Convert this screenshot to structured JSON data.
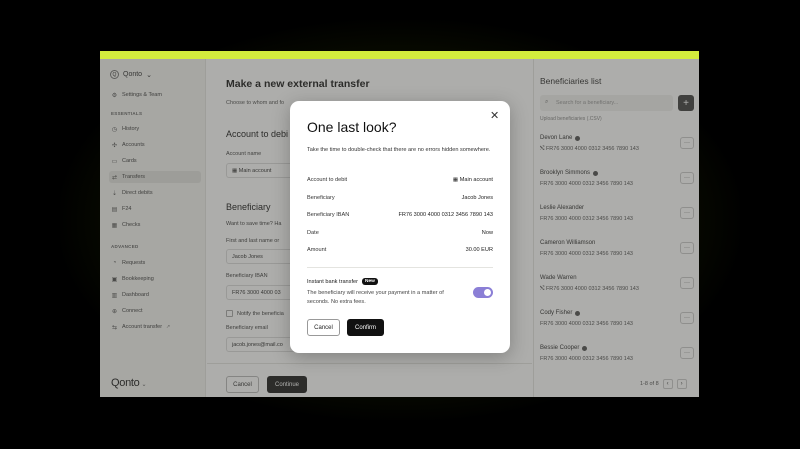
{
  "sidebar": {
    "org_name": "Qonto",
    "settings": "Settings & Team",
    "essentials_label": "ESSENTIALS",
    "essentials": [
      {
        "label": "History",
        "icon": "clock-icon"
      },
      {
        "label": "Accounts",
        "icon": "accounts-icon"
      },
      {
        "label": "Cards",
        "icon": "card-icon"
      },
      {
        "label": "Transfers",
        "icon": "transfer-icon"
      },
      {
        "label": "Direct debits",
        "icon": "debit-icon"
      },
      {
        "label": "F24",
        "icon": "f24-icon"
      },
      {
        "label": "Checks",
        "icon": "check-icon"
      }
    ],
    "advanced_label": "ADVANCED",
    "advanced": [
      {
        "label": "Requests",
        "icon": "requests-icon"
      },
      {
        "label": "Bookkeeping",
        "icon": "book-icon"
      },
      {
        "label": "Dashboard",
        "icon": "dashboard-icon"
      },
      {
        "label": "Connect",
        "icon": "connect-icon"
      },
      {
        "label": "Account transfer",
        "icon": "account-transfer-icon"
      }
    ],
    "logo": "Qonto"
  },
  "main": {
    "title": "Make a new external transfer",
    "subtitle": "Choose to whom and fo",
    "account_heading": "Account to debi",
    "account_name_label": "Account name",
    "account_value": "Main account",
    "beneficiary_heading": "Beneficiary",
    "save_question": "Want to save time? Ha",
    "name_label": "First and last name or",
    "name_value": "Jacob Jones",
    "iban_label": "Beneficiary IBAN",
    "iban_value": "FR76 3000 4000 03",
    "notify_label": "Notify the beneficia",
    "email_label": "Beneficiary email",
    "email_value": "jacob.jones@mail.co",
    "cancel": "Cancel",
    "continue": "Continue"
  },
  "beneficiaries": {
    "title": "Beneficiaries list",
    "search_placeholder": "Search for a beneficiary...",
    "upload": "Upload beneficiaries (.CSV)",
    "items": [
      {
        "name": "Devon Lane",
        "iban": "FR76 3000 4000 0312 3456 7890 143",
        "verified": true
      },
      {
        "name": "Brooklyn Simmons",
        "iban": "FR76 3000 4000 0312 3456 7890 143",
        "verified": true
      },
      {
        "name": "Leslie Alexander",
        "iban": "FR76 3000 4000 0312 3456 7890 143",
        "verified": false
      },
      {
        "name": "Cameron Williamson",
        "iban": "FR76 3000 4000 0312 3456 7890 143",
        "verified": false
      },
      {
        "name": "Wade Warren",
        "iban": "FR76 3000 4000 0312 3456 7890 143",
        "verified": false
      },
      {
        "name": "Cody Fisher",
        "iban": "FR76 3000 4000 0312 3456 7890 143",
        "verified": true
      },
      {
        "name": "Bessie Cooper",
        "iban": "FR76 3000 4000 0312 3456 7890 143",
        "verified": true
      }
    ],
    "pagination": "1-8 of 8"
  },
  "modal": {
    "title": "One last look?",
    "description": "Take the time to double-check that there are no errors hidden somewhere.",
    "rows": [
      {
        "key": "Account to debit",
        "value": "Main account"
      },
      {
        "key": "Beneficiary",
        "value": "Jacob Jones"
      },
      {
        "key": "Beneficiary IBAN",
        "value": "FR76 3000 4000 0312 3456 7890 143"
      },
      {
        "key": "Date",
        "value": "Now"
      },
      {
        "key": "Amount",
        "value": "30.00 EUR"
      }
    ],
    "instant_label": "Instant bank transfer",
    "instant_badge": "New",
    "instant_desc": "The beneficiary will receive your payment in a matter of seconds. No extra fees.",
    "instant_enabled": true,
    "cancel": "Cancel",
    "confirm": "Confirm"
  },
  "colors": {
    "accent_bar": "#d3ec3d",
    "toggle": "#8b7fd6",
    "glow": "#bee614"
  }
}
